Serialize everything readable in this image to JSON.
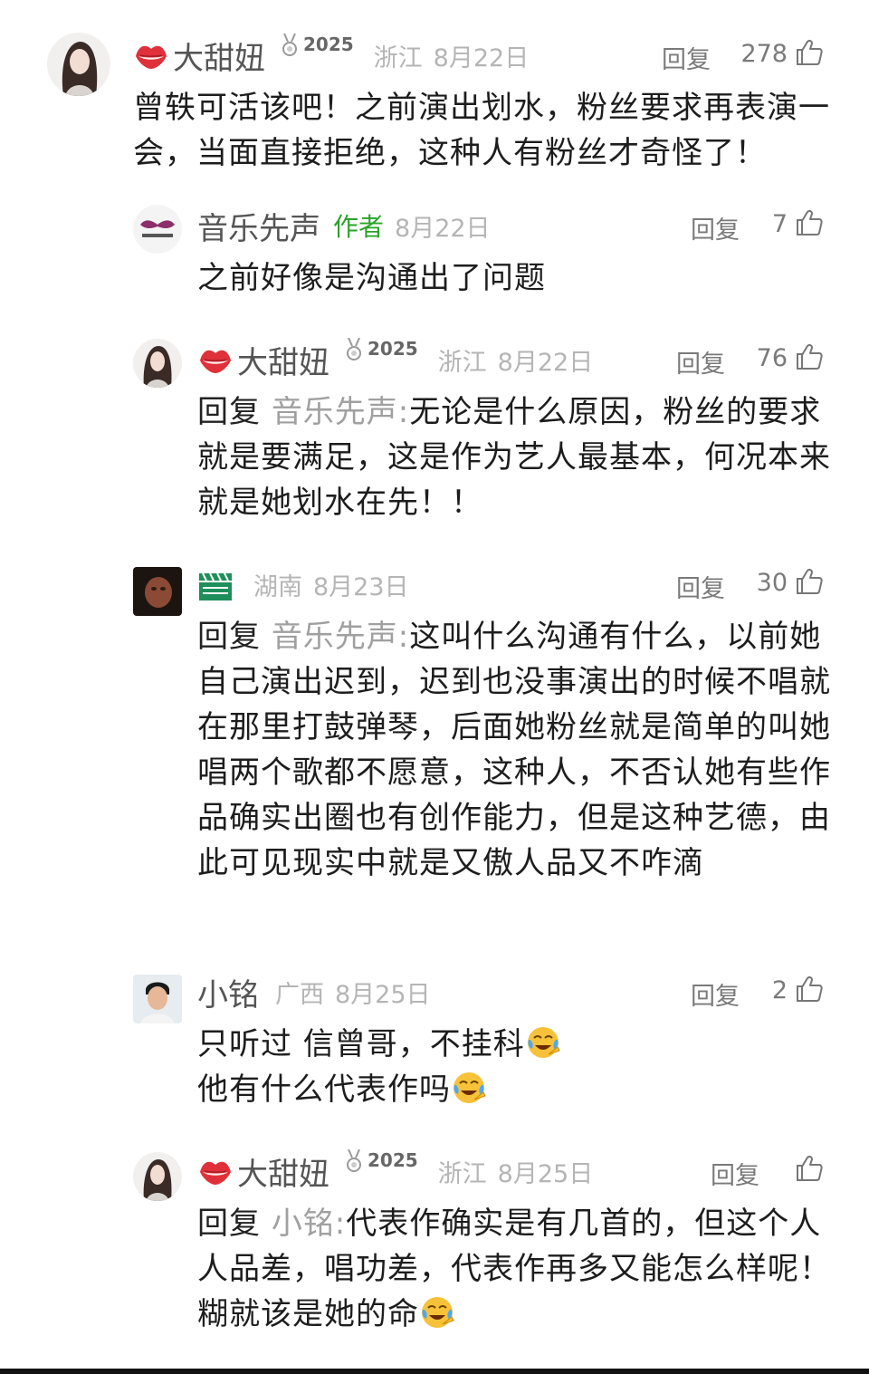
{
  "comments": [
    {
      "name": "大甜妞",
      "badge_year": "2025",
      "region": "浙江",
      "date": "8月22日",
      "reply_label": "回复",
      "likes": "278",
      "body": "曾轶可活该吧！之前演出划水，粉丝要求再表演一会，当面直接拒绝，这种人有粉丝才奇怪了！"
    },
    {
      "name": "音乐先声",
      "author_tag": "作者",
      "date": "8月22日",
      "reply_label": "回复",
      "likes": "7",
      "body": "之前好像是沟通出了问题"
    },
    {
      "name": "大甜妞",
      "badge_year": "2025",
      "region": "浙江",
      "date": "8月22日",
      "reply_label": "回复",
      "likes": "76",
      "reply_prefix": "回复",
      "reply_to": "音乐先声:",
      "body": "无论是什么原因，粉丝的要求就是要满足，这是作为艺人最基本，何况本来就是她划水在先！！"
    },
    {
      "region": "湖南",
      "date": "8月23日",
      "reply_label": "回复",
      "likes": "30",
      "reply_prefix": "回复",
      "reply_to": "音乐先声:",
      "body": "这叫什么沟通有什么，以前她自己演出迟到，迟到也没事演出的时候不唱就在那里打鼓弹琴，后面她粉丝就是简单的叫她唱两个歌都不愿意，这种人，不否认她有些作品确实出圈也有创作能力，但是这种艺德，由此可见现实中就是又傲人品又不咋滴"
    },
    {
      "name": "小铭",
      "region": "广西",
      "date": "8月25日",
      "reply_label": "回复",
      "likes": "2",
      "body_line1": "只听过 信曾哥，不挂科",
      "body_line2": "他有什么代表作吗"
    },
    {
      "name": "大甜妞",
      "badge_year": "2025",
      "region": "浙江",
      "date": "8月25日",
      "reply_label": "回复",
      "likes": "",
      "reply_prefix": "回复",
      "reply_to": "小铭:",
      "body": "代表作确实是有几首的，但这个人人品差，唱功差，代表作再多又能怎么样呢！糊就该是她的命"
    }
  ],
  "icons": {
    "like": "thumbs-up-icon",
    "lips": "red-lips-icon",
    "emoji": "laughing-crying-emoji",
    "film": "film-clapper-icon"
  },
  "colors": {
    "lips": "#e0303a",
    "author_green": "#2aa32a",
    "meta_gray": "#b5b5b5",
    "reply_target_gray": "#a0a0a0"
  }
}
